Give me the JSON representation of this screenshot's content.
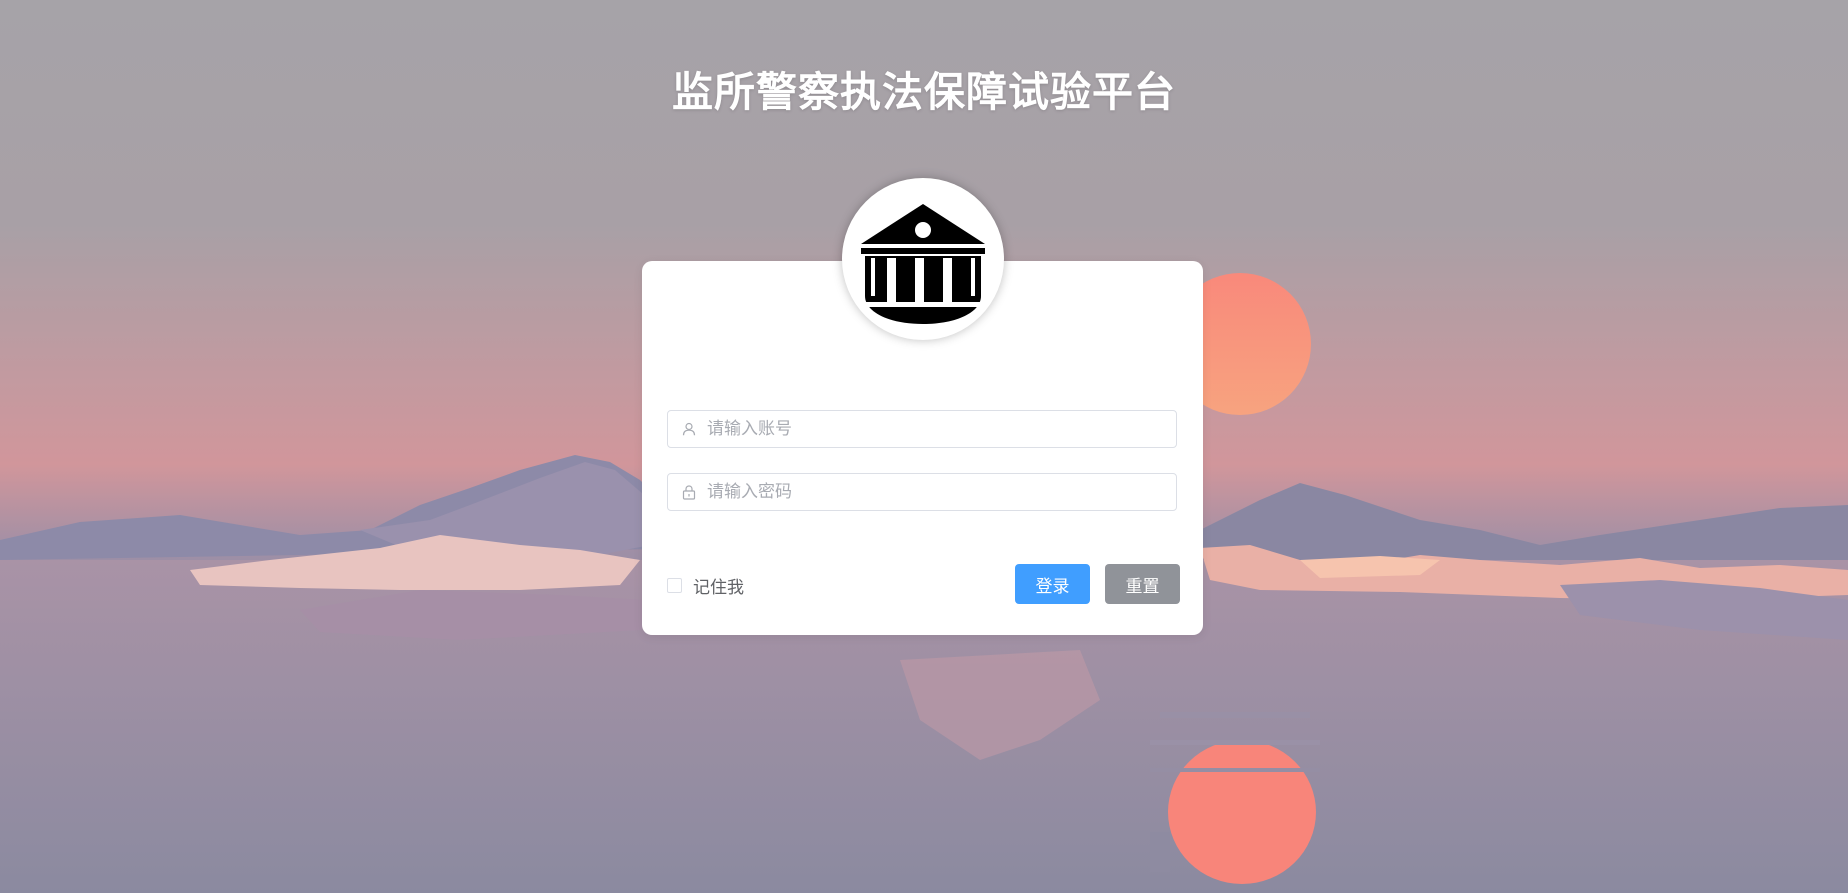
{
  "page": {
    "title": "监所警察执法保障试验平台"
  },
  "avatar": {
    "icon": "bank-building-icon"
  },
  "form": {
    "username": {
      "placeholder": "请输入账号",
      "value": "",
      "icon": "user-icon"
    },
    "password": {
      "placeholder": "请输入密码",
      "value": "",
      "icon": "lock-icon"
    },
    "remember_label": "记住我",
    "remember_checked": false,
    "login_label": "登录",
    "reset_label": "重置"
  },
  "colors": {
    "primary": "#409eff",
    "secondary": "#909399",
    "title": "#ffffff",
    "sun": "#f8857a"
  }
}
